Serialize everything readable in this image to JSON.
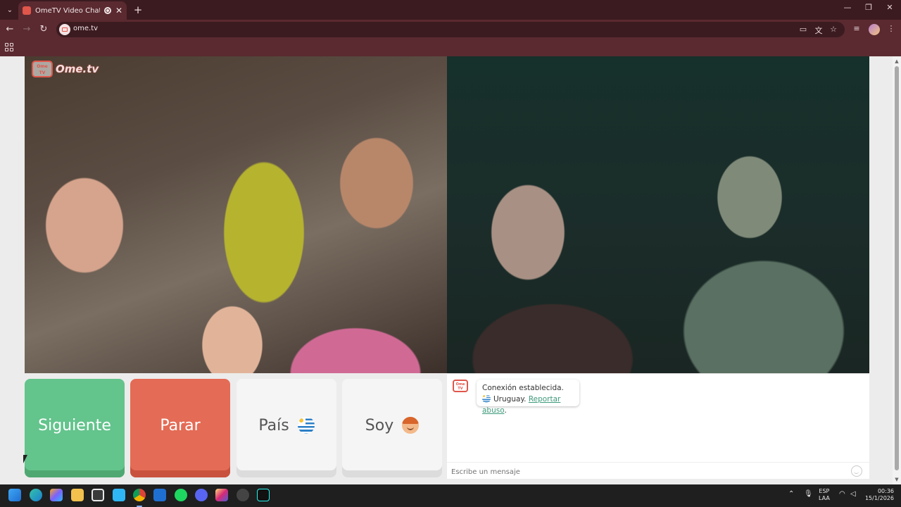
{
  "browser": {
    "tab_title": "OmeTV Video Chat — Ome",
    "url": "ome.tv",
    "new_tab_symbol": "+",
    "tab_close_symbol": "✕"
  },
  "app": {
    "brand_small": "Ome TV",
    "brand": "Ome.tv"
  },
  "controls": {
    "next_label": "Siguiente",
    "stop_label": "Parar",
    "country_label": "País",
    "gender_label": "Soy",
    "country_flag_icon": "uruguay-flag-icon",
    "gender_icon": "boy-emoji-icon"
  },
  "chat": {
    "system_logo": "Ome TV",
    "message_line1": "Conexión establecida.",
    "message_country": "Uruguay.",
    "message_report_link": "Reportar abuso",
    "message_suffix": ".",
    "input_placeholder": "Escribe un mensaje"
  },
  "taskbar": {
    "lang_top": "ESP",
    "lang_bottom": "LAA",
    "time": "00:36",
    "date": "15/1/2026"
  },
  "colors": {
    "next": "#63c48c",
    "stop": "#e46b55",
    "brand": "#e0564b",
    "link": "#3e9a7a",
    "chrome_dark": "#3b1b20",
    "chrome": "#5a2a30"
  }
}
